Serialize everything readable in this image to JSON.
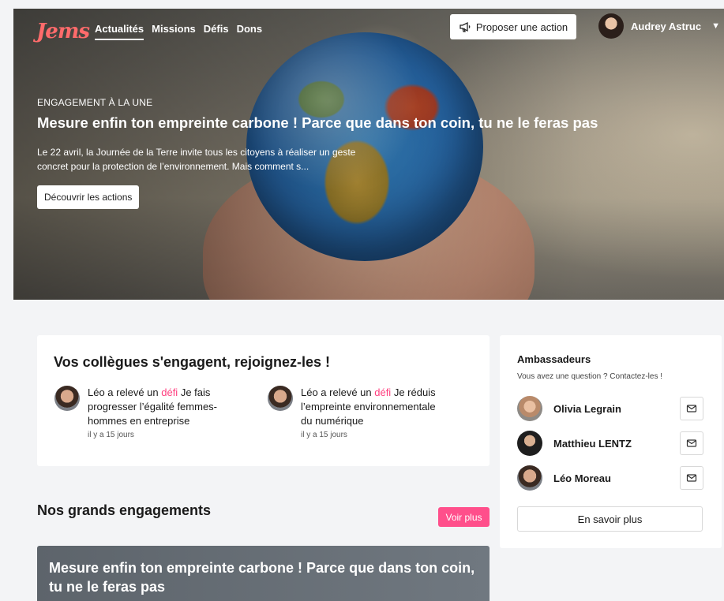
{
  "brand": {
    "logo_text": "Jems",
    "logo_color": "#ff6b6b",
    "accent_color": "#ff4f8b"
  },
  "nav": {
    "items": [
      {
        "label": "Actualités",
        "active": true
      },
      {
        "label": "Missions",
        "active": false
      },
      {
        "label": "Défis",
        "active": false
      },
      {
        "label": "Dons",
        "active": false
      }
    ],
    "propose_action": {
      "label": "Proposer une action",
      "icon": "megaphone-icon"
    },
    "user": {
      "name": "Audrey Astruc",
      "icon": "chevron-down-icon"
    }
  },
  "hero": {
    "kicker": "ENGAGEMENT À LA UNE",
    "title": "Mesure enfin ton empreinte carbone ! Parce que dans ton coin, tu ne le feras pas",
    "description": "Le 22 avril, la Journée de la Terre invite tous les citoyens à réaliser un geste concret pour la protection de l’environnement. Mais comment s...",
    "cta": "Découvrir les actions"
  },
  "colleagues": {
    "title": "Vos collègues s'engagent, rejoignez-les !",
    "activities": [
      {
        "prefix": "Léo a relevé un ",
        "highlight": "défi",
        "suffix": " Je fais progresser l’égalité femmes-hommes en entreprise",
        "time": "il y a 15 jours"
      },
      {
        "prefix": "Léo a relevé un ",
        "highlight": "défi",
        "suffix": " Je réduis l’empreinte environnementale du numérique",
        "time": "il y a 15 jours"
      }
    ]
  },
  "engagements": {
    "title": "Nos grands engagements",
    "see_more": "Voir plus",
    "featured_title": "Mesure enfin ton empreinte carbone ! Parce que dans ton coin, tu ne le feras pas"
  },
  "ambassadors": {
    "title": "Ambassadeurs",
    "subtitle": "Vous avez une question ? Contactez-les !",
    "people": [
      {
        "name": "Olivia Legrain",
        "icon": "mail-icon"
      },
      {
        "name": "Matthieu LENTZ",
        "icon": "mail-icon"
      },
      {
        "name": "Léo Moreau",
        "icon": "mail-icon"
      }
    ],
    "learn_more": "En savoir plus"
  }
}
